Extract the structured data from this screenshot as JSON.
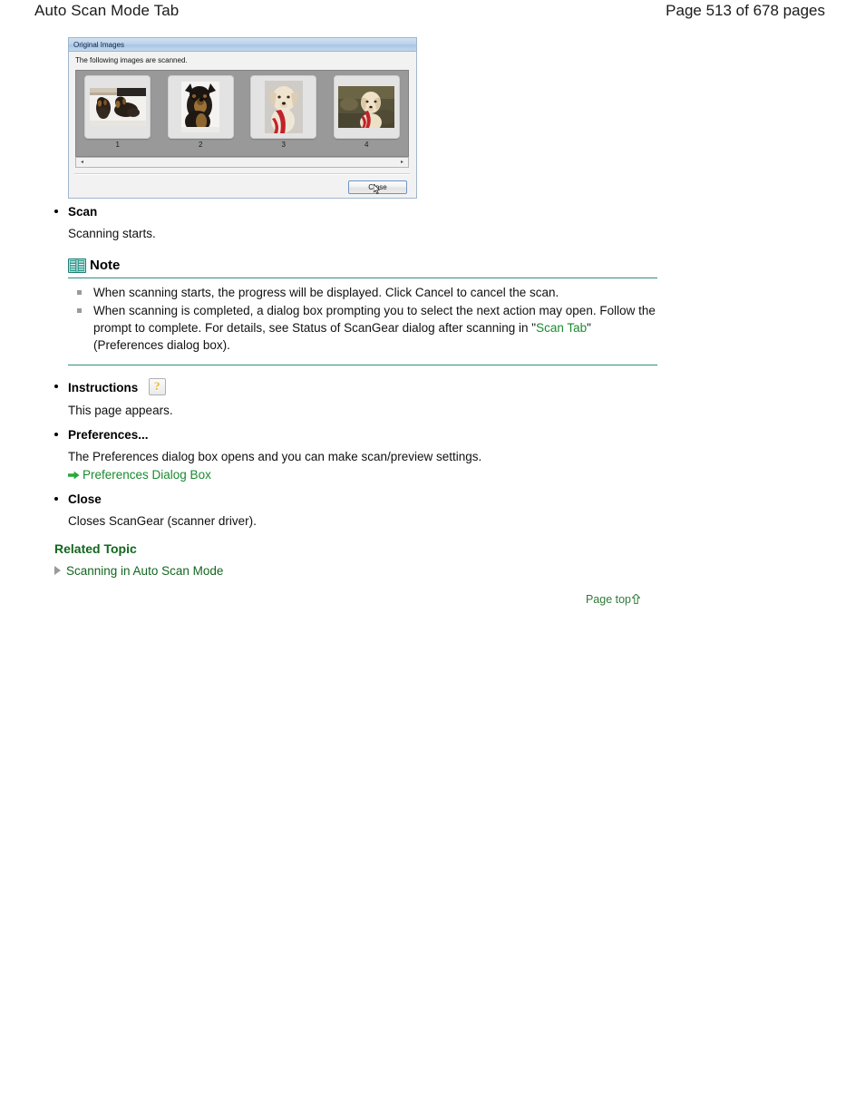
{
  "header": {
    "title": "Auto Scan Mode Tab",
    "page_info": "Page 513 of 678 pages"
  },
  "dialog": {
    "title": "Original Images",
    "instruction": "The following images are scanned.",
    "thumbnails": [
      {
        "caption": "1",
        "alt": "two-dachshund-puppies-photo"
      },
      {
        "caption": "2",
        "alt": "black-and-tan-dog-portrait-photo"
      },
      {
        "caption": "3",
        "alt": "yellow-labrador-with-red-leash-photo"
      },
      {
        "caption": "4",
        "alt": "yellow-labrador-outdoors-photo"
      }
    ],
    "scroll_left": "◂",
    "scroll_right": "▸",
    "close_button": "Close"
  },
  "sections": [
    {
      "title": "Scan",
      "description": "Scanning starts."
    },
    {
      "title": "Instructions",
      "description": "This page appears.",
      "icon": "help-question-icon"
    },
    {
      "title": "Preferences...",
      "description": "The Preferences dialog box opens and you can make scan/preview settings.",
      "link": "Preferences Dialog Box"
    },
    {
      "title": "Close",
      "description": "Closes ScanGear (scanner driver)."
    }
  ],
  "note": {
    "label": "Note",
    "items": [
      {
        "text": "When scanning starts, the progress will be displayed. Click Cancel to cancel the scan."
      },
      {
        "text_before": "When scanning is completed, a dialog box prompting you to select the next action may open. Follow the prompt to complete. For details, see Status of ScanGear dialog after scanning in \"",
        "link": "Scan Tab",
        "text_after": "\" (Preferences dialog box)."
      }
    ]
  },
  "related": {
    "title": "Related Topic",
    "link": "Scanning in Auto Scan Mode"
  },
  "page_top": {
    "label": "Page top"
  },
  "colors": {
    "link_green": "#1a8a2e",
    "heading_green": "#13661f",
    "note_rule": "#2c8d82",
    "arrow_green": "#2aa63a",
    "bullet_gray": "#9a9a9a"
  }
}
